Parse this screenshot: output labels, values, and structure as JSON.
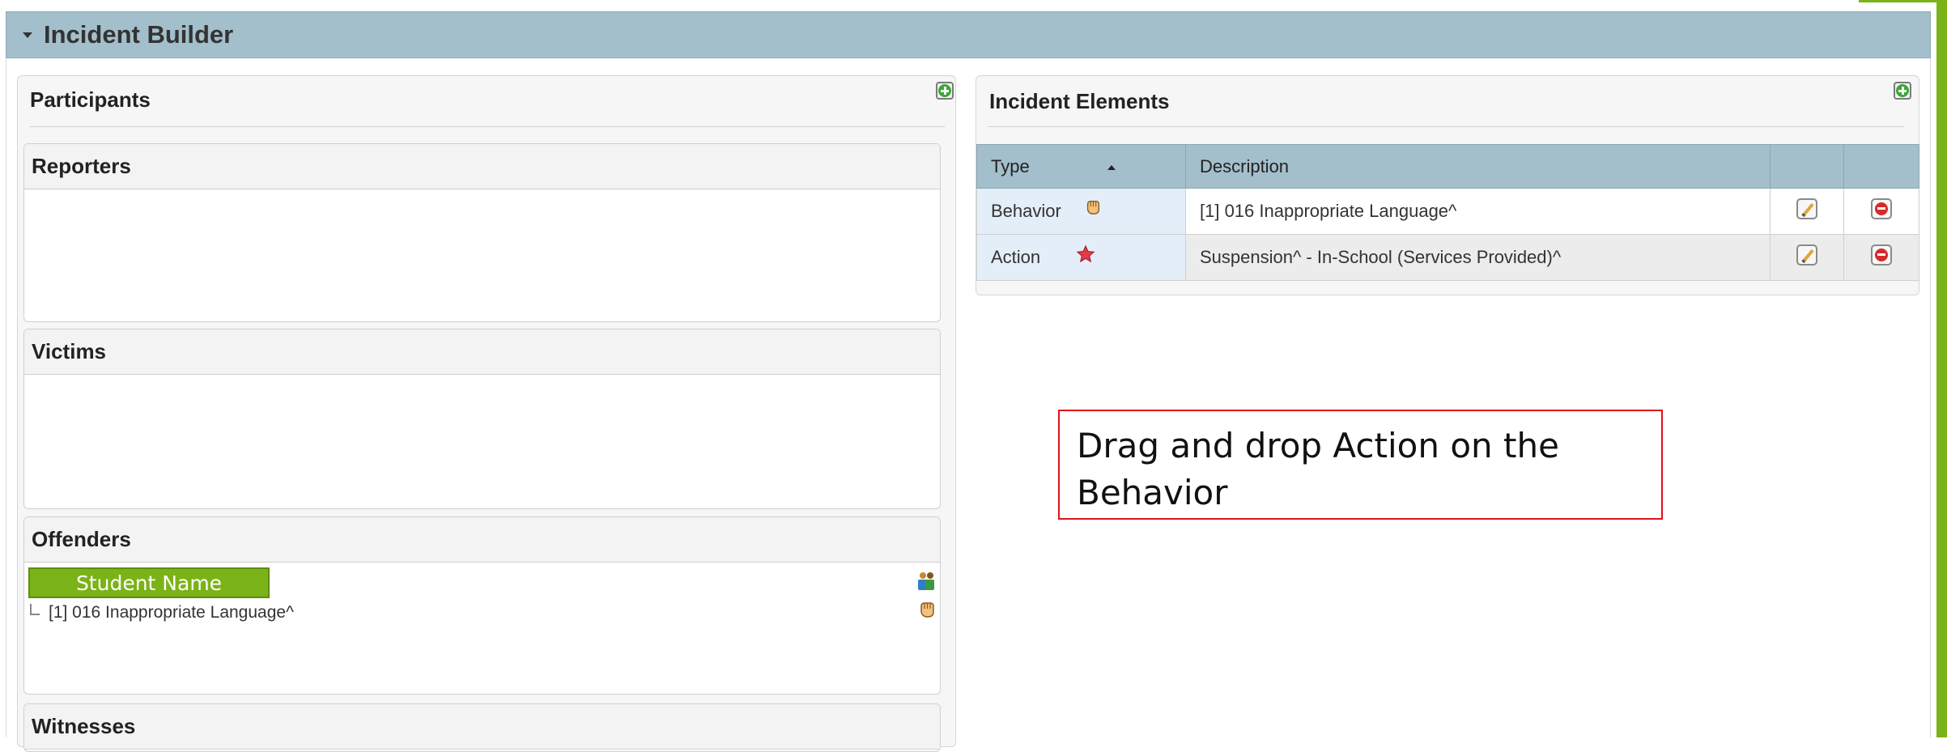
{
  "panel": {
    "title": "Incident Builder"
  },
  "participants": {
    "title": "Participants",
    "groups": {
      "reporters": {
        "label": "Reporters"
      },
      "victims": {
        "label": "Victims"
      },
      "offenders": {
        "label": "Offenders",
        "student_name": "Student Name",
        "offense": "[1] 016 Inappropriate Language^"
      },
      "witnesses": {
        "label": "Witnesses"
      }
    }
  },
  "incident_elements": {
    "title": "Incident Elements",
    "columns": {
      "type": "Type",
      "description": "Description"
    },
    "sort": "Type ascending",
    "rows": [
      {
        "type": "Behavior",
        "icon": "fist-icon",
        "description": "[1] 016 Inappropriate Language^"
      },
      {
        "type": "Action",
        "icon": "star-icon",
        "description": "Suspension^ - In-School (Services Provided)^"
      }
    ]
  },
  "instruction": {
    "text": "Drag and drop Action on the Behavior"
  },
  "colors": {
    "header_bg": "#a3bfcb",
    "accent_green": "#7ab317",
    "callout_border": "#e0121b",
    "type_cell_bg": "#e3eef9"
  }
}
